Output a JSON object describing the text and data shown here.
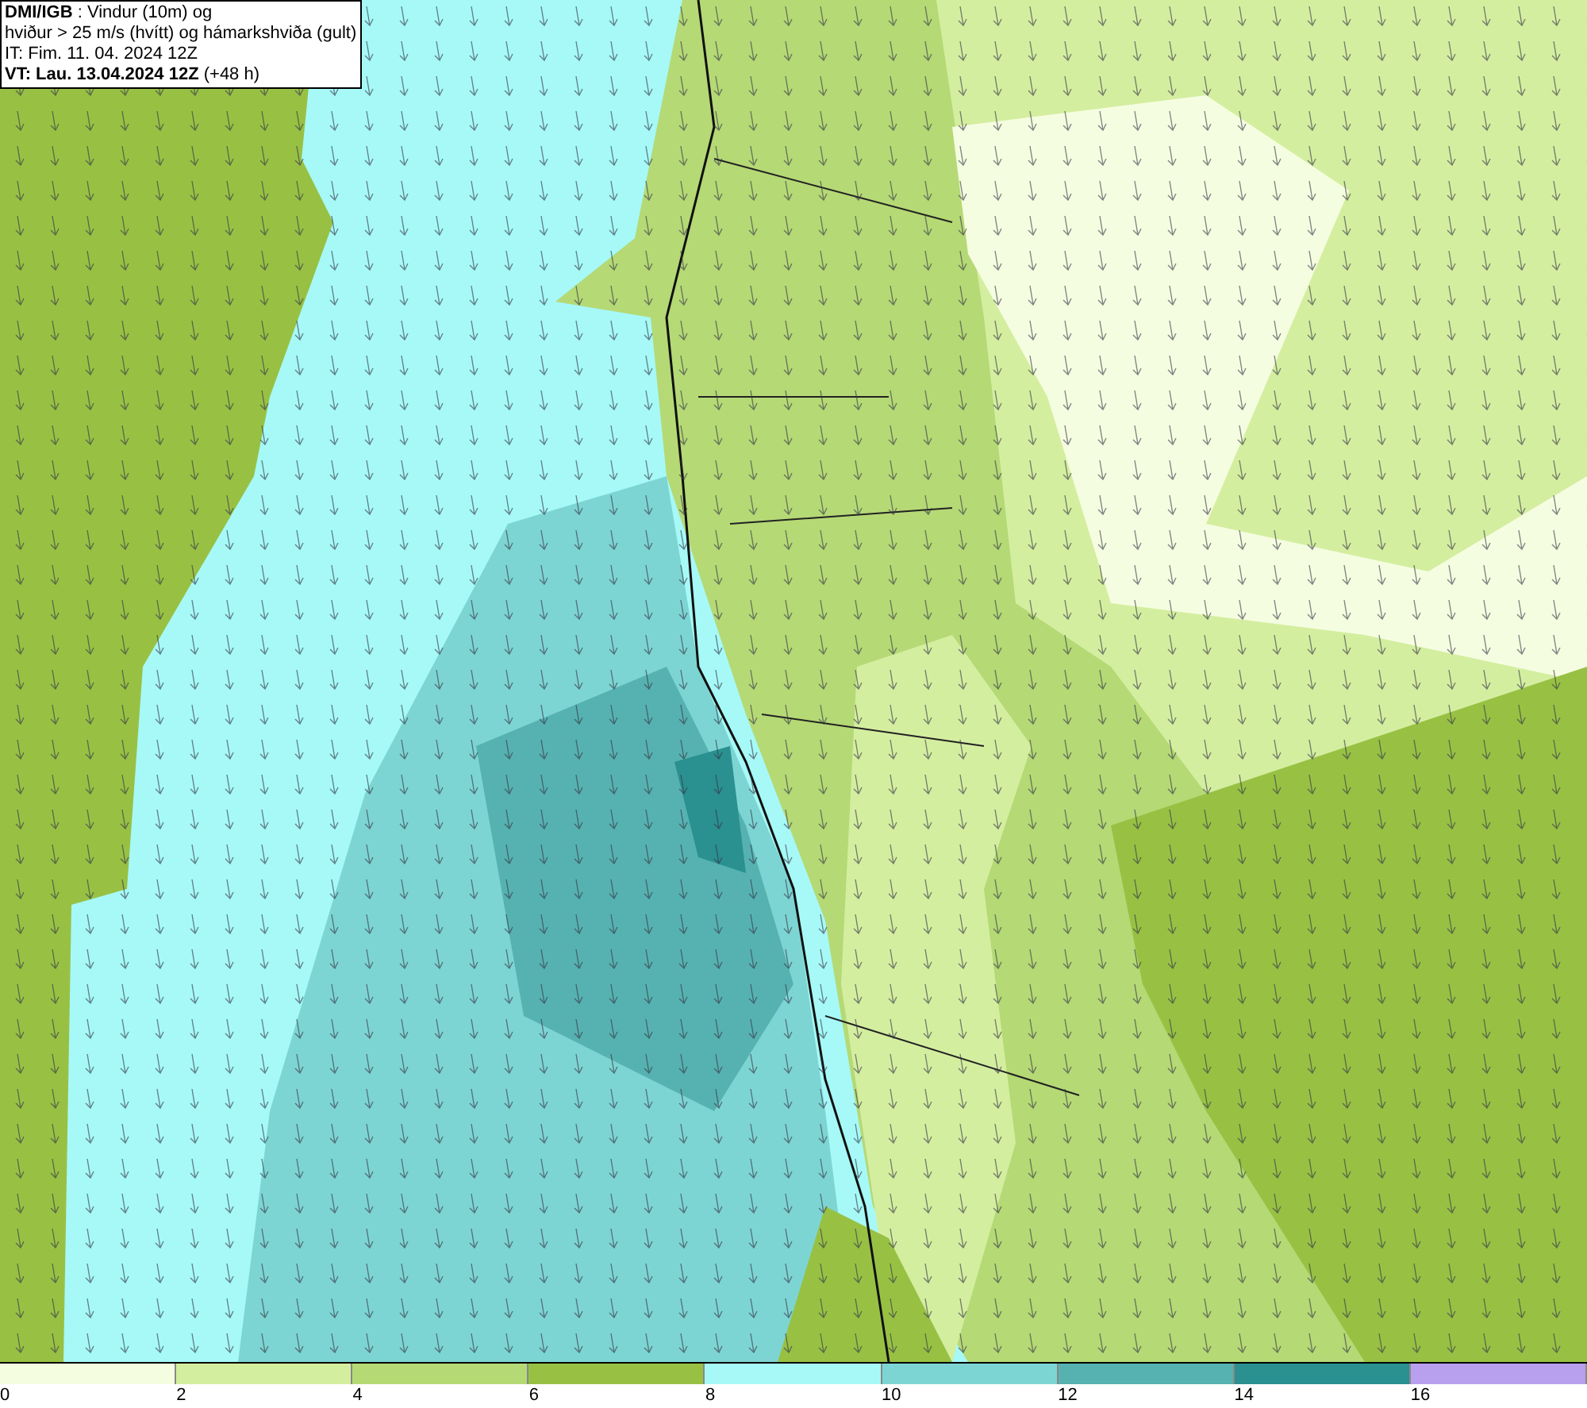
{
  "title_box": {
    "lines": [
      "**DMI/IGB** : Vindur (10m) og",
      "hviður > 25 m/s (hvítt) og hámarkshviða (gult)",
      "IT: Fim. 11. 04. 2024 12Z",
      "**VT: Lau. 13.04.2024 12Z** (+48 h)"
    ]
  },
  "legend": [
    {
      "color": "#f5fde0",
      "label": "0"
    },
    {
      "color": "#d4eea0",
      "label": "2"
    },
    {
      "color": "#b5d975",
      "label": "4"
    },
    {
      "color": "#98c144",
      "label": "6"
    },
    {
      "color": "#a6f9f7",
      "label": "8"
    },
    {
      "color": "#7dd5d3",
      "label": "10"
    },
    {
      "color": "#56b2b0",
      "label": "12"
    },
    {
      "color": "#2a9090",
      "label": "14"
    },
    {
      "color": "#b8a0ee",
      "label": "16"
    }
  ]
}
